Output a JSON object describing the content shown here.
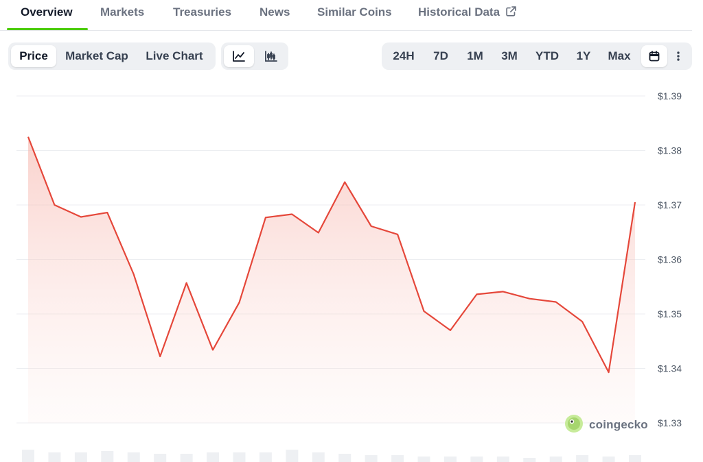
{
  "tabs": [
    {
      "label": "Overview",
      "active": true
    },
    {
      "label": "Markets"
    },
    {
      "label": "Treasuries"
    },
    {
      "label": "News"
    },
    {
      "label": "Similar Coins"
    },
    {
      "label": "Historical Data",
      "icon": "external-link-icon"
    }
  ],
  "chart_type_toggle": {
    "options": [
      "Price",
      "Market Cap",
      "Live Chart"
    ],
    "selected": "Price"
  },
  "chart_style_toggle": {
    "options": [
      {
        "icon": "line-chart-icon",
        "selected": true
      },
      {
        "icon": "candlestick-chart-icon",
        "selected": false
      }
    ]
  },
  "range_toggle": {
    "options": [
      "24H",
      "7D",
      "1M",
      "3M",
      "YTD",
      "1Y",
      "Max"
    ],
    "selected_icon": "calendar-icon",
    "more_icon": "more-vertical-icon"
  },
  "watermark": {
    "text": "coingecko"
  },
  "colors": {
    "line": "#e5473a",
    "area": "#fbd7d2",
    "accent_underline": "#4bcc00",
    "grid": "#eceef1"
  },
  "chart_data": {
    "type": "area",
    "yaxis_position": "right",
    "ylim": [
      1.33,
      1.39
    ],
    "yticks": [
      1.39,
      1.38,
      1.37,
      1.36,
      1.35,
      1.34,
      1.33
    ],
    "ytick_labels": [
      "$1.39",
      "$1.38",
      "$1.37",
      "$1.36",
      "$1.35",
      "$1.34",
      "$1.33"
    ],
    "grid": true,
    "series": [
      {
        "values": [
          1.3825,
          1.37,
          1.3678,
          1.3686,
          1.3573,
          1.3422,
          1.3557,
          1.3434,
          1.3521,
          1.3677,
          1.3683,
          1.3649,
          1.3742,
          1.3661,
          1.3646,
          1.3505,
          1.347,
          1.3536,
          1.3541,
          1.3528,
          1.3522,
          1.3486,
          1.3393,
          1.3705
        ]
      }
    ],
    "volume_bars": [
      0.7,
      0.5,
      0.5,
      0.6,
      0.5,
      0.4,
      0.4,
      0.5,
      0.5,
      0.5,
      0.7,
      0.5,
      0.4,
      0.3,
      0.3,
      0.2,
      0.2,
      0.2,
      0.2,
      0.1,
      0.2,
      0.3,
      0.2,
      0.3
    ]
  }
}
